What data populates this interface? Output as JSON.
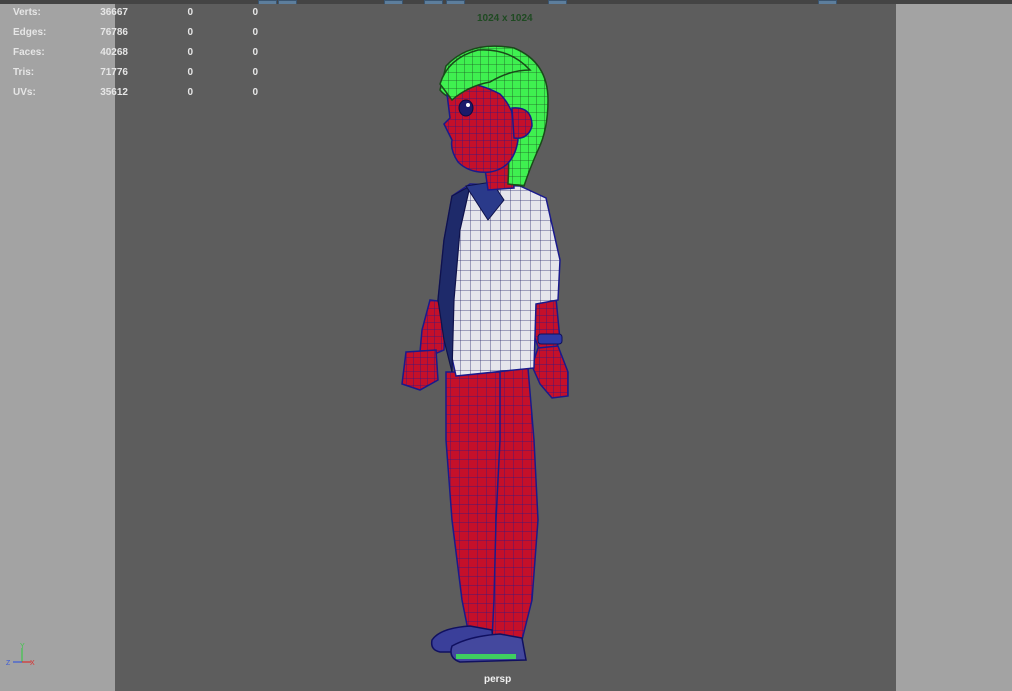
{
  "viewport": {
    "resolution_label": "1024 x 1024",
    "camera_label": "persp"
  },
  "hud": {
    "rows": [
      {
        "label": "Verts:",
        "v1": "36667",
        "v2": "0",
        "v3": "0"
      },
      {
        "label": "Edges:",
        "v1": "76786",
        "v2": "0",
        "v3": "0"
      },
      {
        "label": "Faces:",
        "v1": "40268",
        "v2": "0",
        "v3": "0"
      },
      {
        "label": "Tris:",
        "v1": "71776",
        "v2": "0",
        "v3": "0"
      },
      {
        "label": "UVs:",
        "v1": "35612",
        "v2": "0",
        "v3": "0"
      }
    ]
  },
  "axis": {
    "y_label": "Y",
    "z_label": "Z",
    "x_label": "X"
  },
  "colors": {
    "hair": "#3ff050",
    "skin": "#c5102a",
    "wire": "#1a1a8c",
    "shirt": "#e8e8ee",
    "viewport_bg": "#5d5d5d",
    "gate": "#a3a3a3"
  }
}
